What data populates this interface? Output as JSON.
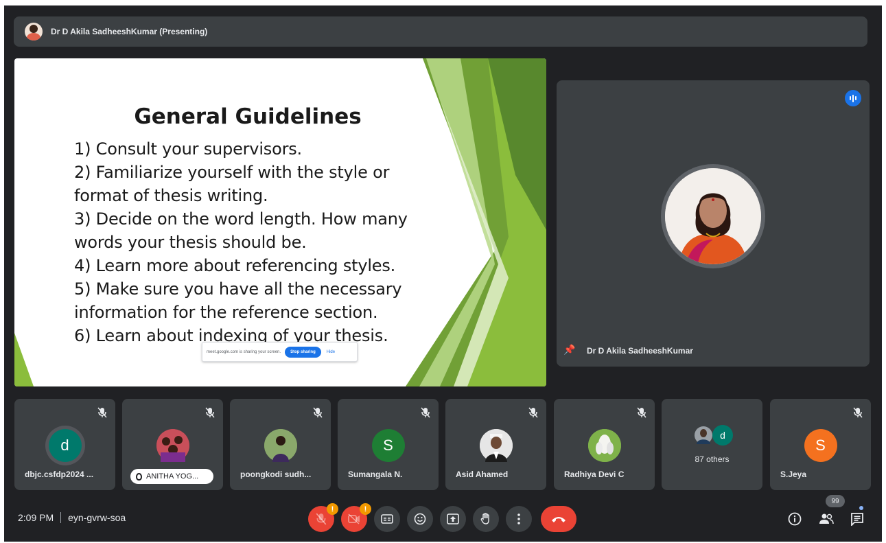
{
  "header": {
    "presenter_title": "Dr D Akila SadheeshKumar (Presenting)"
  },
  "slide": {
    "heading": "General Guidelines",
    "lines": [
      "1) Consult your supervisors.",
      "2) Familiarize yourself with the style or",
      "format of thesis writing.",
      "3) Decide on the word length. How many",
      "words your thesis should be.",
      "4) Learn more about referencing styles.",
      "5) Make sure you have all the necessary",
      "information for the reference section.",
      "6) Learn about indexing of your thesis."
    ],
    "share_bar": {
      "message": "meet.google.com is sharing your screen.",
      "stop_label": "Stop sharing",
      "hide_label": "Hide"
    }
  },
  "speaker": {
    "name": "Dr D Akila SadheeshKumar",
    "pin_icon": "pin-icon",
    "speaking_icon": "audio-level-icon"
  },
  "participants": [
    {
      "name": "dbjc.csfdp2024 ...",
      "initial": "d",
      "color": "#00796b",
      "kind": "letter",
      "muted": true
    },
    {
      "name": "ANITHA YOG...",
      "initial": "",
      "color": "#b23a48",
      "kind": "photo",
      "muted": true,
      "highlight": true
    },
    {
      "name": "poongkodi sudh...",
      "initial": "",
      "color": "#6b8e4e",
      "kind": "photo",
      "muted": true
    },
    {
      "name": "Sumangala N.",
      "initial": "S",
      "color": "#1e7e34",
      "kind": "letter",
      "muted": true
    },
    {
      "name": "Asid Ahamed",
      "initial": "",
      "color": "#d8d8d8",
      "kind": "photo",
      "muted": true
    },
    {
      "name": "Radhiya Devi C",
      "initial": "",
      "color": "#7fb24a",
      "kind": "photo",
      "muted": true
    },
    {
      "name": "S.Jeya",
      "initial": "S",
      "color": "#f4711f",
      "kind": "letter",
      "muted": true
    }
  ],
  "others_tile": {
    "label": "87 others",
    "mini_initial": "d",
    "mini_color": "#00796b"
  },
  "bottom_bar": {
    "time": "2:09 PM",
    "meeting_code": "eyn-gvrw-soa",
    "mic_badge": "!",
    "camera_badge": "!",
    "people_count": "99"
  }
}
